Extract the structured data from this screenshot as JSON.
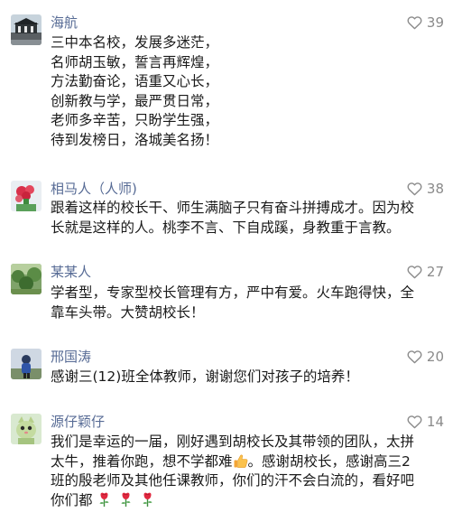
{
  "comments": [
    {
      "author": "海航",
      "likes": "39",
      "lines": [
        "三中本名校，发展多迷茫，",
        "名师胡玉敏，誓言再辉煌，",
        "方法勤奋论，语重又心长，",
        "创新教与学，最严贯日常，",
        "老师多辛苦，只盼学生强，",
        "待到发榜日，洛城美名扬！"
      ]
    },
    {
      "author": "相马人（人师)",
      "likes": "38",
      "lines": [
        "跟着这样的校长干、师生满脑子只有奋斗拼搏成才。因为校",
        "长就是这样的人。桃李不言、下自成蹊，身教重于言教。"
      ]
    },
    {
      "author": "某某人",
      "likes": "27",
      "lines": [
        "学者型，专家型校长管理有方，严中有爱。火车跑得快，全",
        "靠车头带。大赞胡校长！"
      ]
    },
    {
      "author": "邢国涛",
      "likes": "20",
      "lines": [
        "感谢三(12)班全体教师，谢谢您们对孩子的培养！"
      ]
    },
    {
      "author": "源仔颖仔",
      "likes": "14",
      "line1": "我们是幸运的一届，刚好遇到胡校长及其带领的团队，太拼",
      "line2a": "太牛，推着你跑，想不学都难",
      "line2b": "。感谢胡校长，感谢高三2",
      "line3": "班的殷老师及其他任课教师，你们的汗不会白流的，看好吧",
      "line4": "你们都"
    }
  ],
  "icons": {
    "like": "heart-outline-icon",
    "thumbs_up": "thumbs-up-emoji",
    "rose": "rose-emoji"
  },
  "colors": {
    "author": "#576b95",
    "likes": "#8a8a8a",
    "text": "#1a1a1a"
  }
}
